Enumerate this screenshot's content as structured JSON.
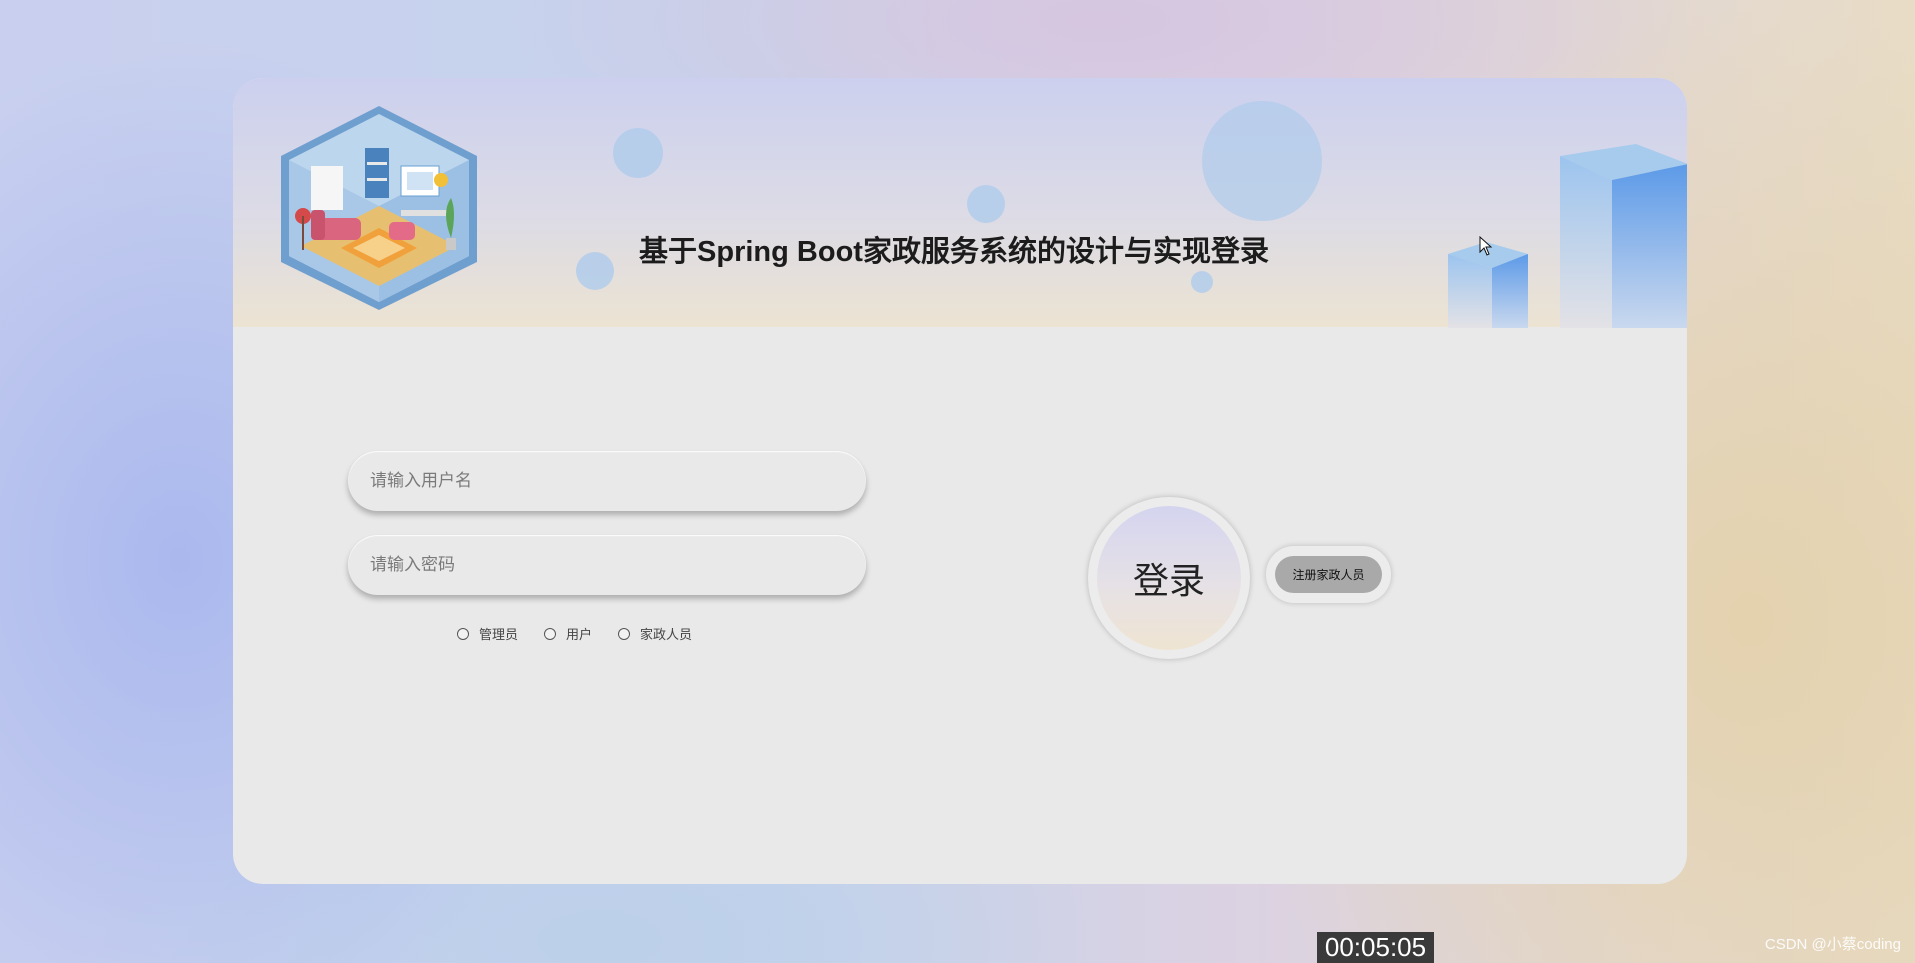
{
  "header": {
    "title": "基于Spring Boot家政服务系统的设计与实现登录"
  },
  "form": {
    "username_placeholder": "请输入用户名",
    "password_placeholder": "请输入密码",
    "roles": [
      "管理员",
      "用户",
      "家政人员"
    ]
  },
  "actions": {
    "login_label": "登录",
    "register_label": "注册家政人员"
  },
  "overlay": {
    "timer": "00:05:05",
    "watermark": "CSDN @小蔡coding"
  },
  "colors": {
    "header_gradient_top": "#ccd0ee",
    "header_gradient_bottom": "#ece3d2",
    "card_body": "#e9e9e9",
    "register_button": "#a9a9a9",
    "cube_blue": "#74aef0"
  }
}
